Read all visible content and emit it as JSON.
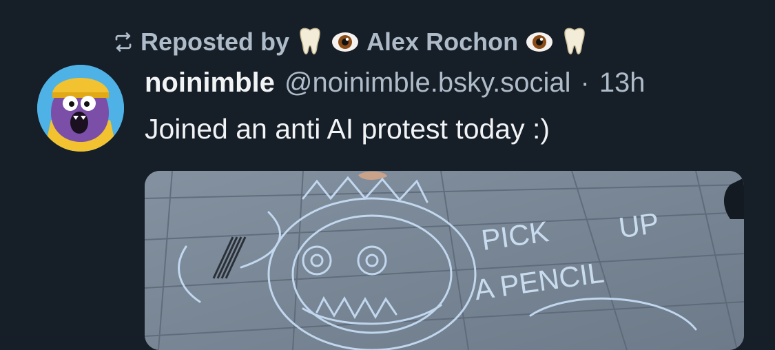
{
  "repost": {
    "label": "Reposted by",
    "reposter": "Alex Rochon",
    "icons": [
      "repost-icon",
      "tooth-emoji",
      "eye-emoji",
      "eye-emoji",
      "tooth-emoji"
    ]
  },
  "post": {
    "display_name": "noinimble",
    "handle": "@noinimble.bsky.social",
    "separator": "·",
    "time": "13h",
    "text": "Joined an anti AI protest today :)"
  },
  "image": {
    "chalk_text_1": "PICK",
    "chalk_text_2": "UP",
    "chalk_text_3": "A PENCIL"
  },
  "colors": {
    "background": "#161e27",
    "muted": "#aebbc9",
    "text": "#f1f3f5",
    "chalk": "#cfe6ff"
  }
}
